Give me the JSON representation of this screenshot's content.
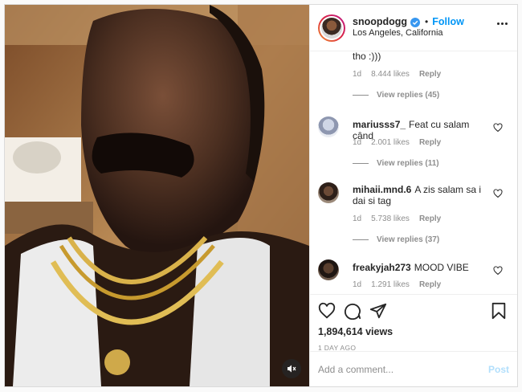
{
  "header": {
    "username": "snoopdogg",
    "separator": "•",
    "follow_label": "Follow",
    "location": "Los Angeles, California",
    "verified_icon": "verified-badge-icon",
    "more_icon": "more-options-icon"
  },
  "comments": [
    {
      "username": "",
      "text": "tho :)))",
      "time": "1d",
      "likes": "8.444 likes",
      "reply": "Reply",
      "view_replies": "View replies (45)"
    },
    {
      "username": "mariusss7_",
      "text": "Feat cu salam când",
      "time": "1d",
      "likes": "2.001 likes",
      "reply": "Reply",
      "view_replies": "View replies (11)"
    },
    {
      "username": "mihaii.mnd.6",
      "text": "A zis salam sa i dai si tag",
      "time": "1d",
      "likes": "5.738 likes",
      "reply": "Reply",
      "view_replies": "View replies (37)"
    },
    {
      "username": "freakyjah273",
      "text": "MOOD VIBE",
      "time": "1d",
      "likes": "1.291 likes",
      "reply": "Reply"
    }
  ],
  "actions": {
    "like_icon": "heart-icon",
    "comment_icon": "comment-icon",
    "share_icon": "share-icon",
    "save_icon": "bookmark-icon"
  },
  "stats": {
    "views": "1,894,614 views",
    "date": "1 DAY AGO"
  },
  "add_comment": {
    "placeholder": "Add a comment...",
    "post_label": "Post"
  },
  "media": {
    "mute_icon": "speaker-muted-icon"
  },
  "colors": {
    "link": "#0095f6",
    "muted_text": "#8e8e8e",
    "post_disabled": "#b2dffc"
  }
}
